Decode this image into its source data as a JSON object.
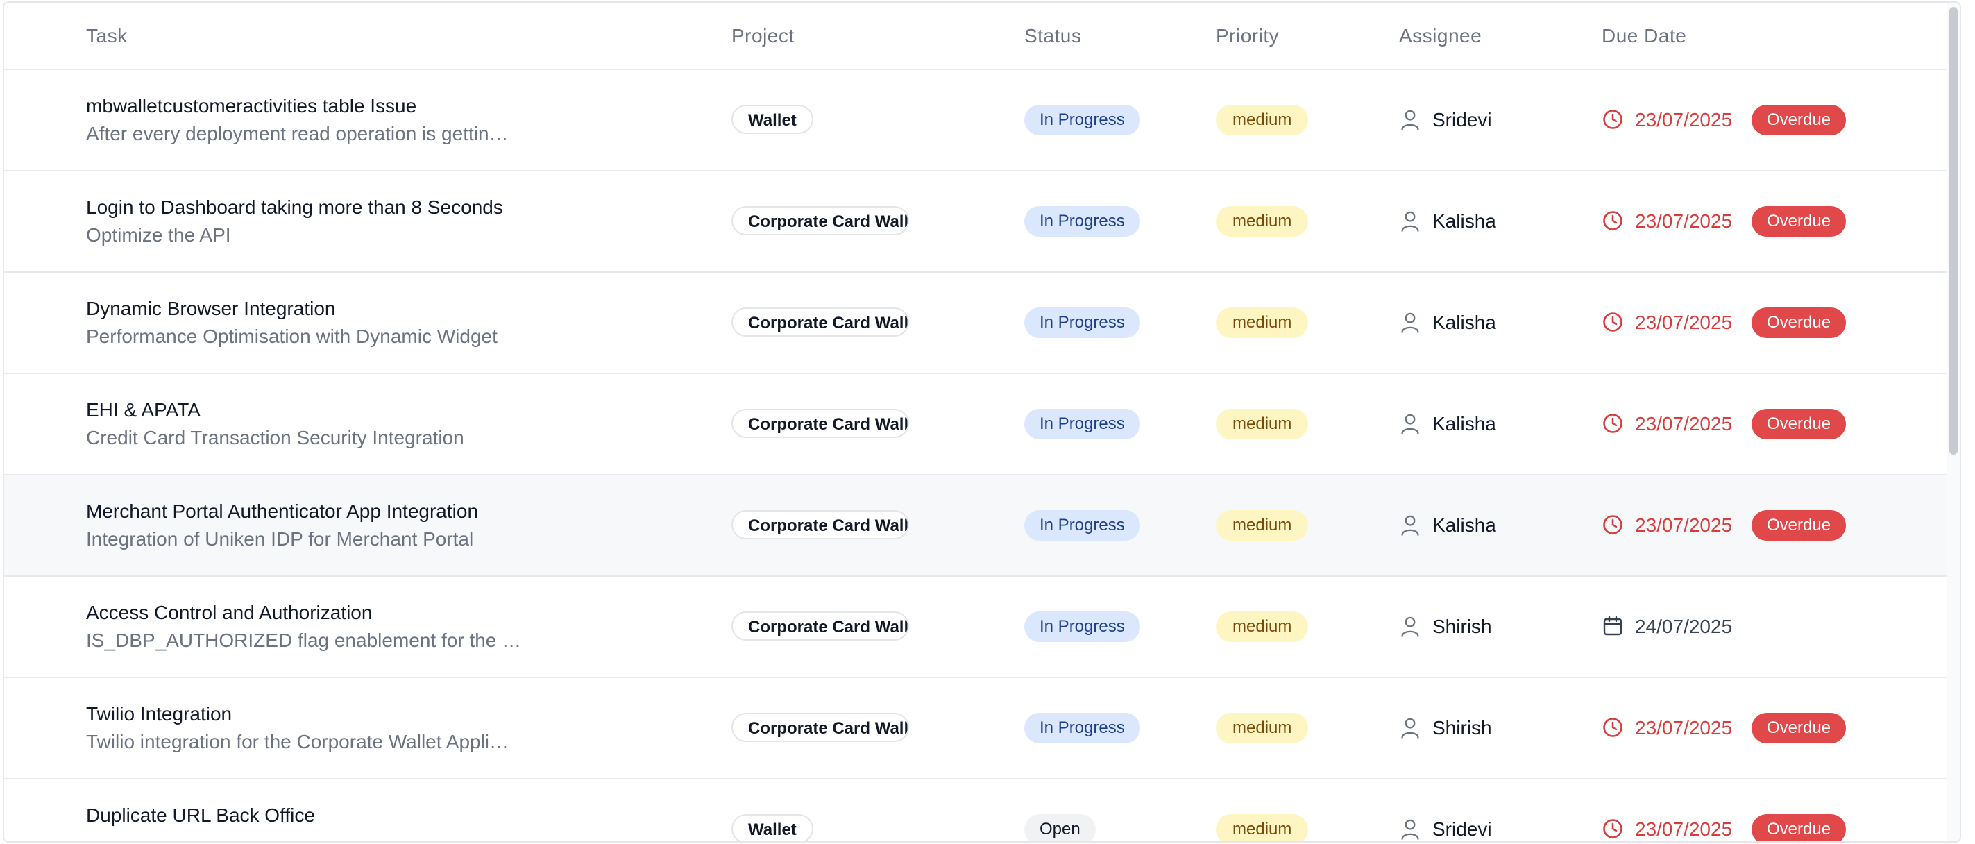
{
  "columns": {
    "task": "Task",
    "project": "Project",
    "status": "Status",
    "priority": "Priority",
    "assignee": "Assignee",
    "due_date": "Due Date"
  },
  "rows": [
    {
      "title": "mbwalletcustomeractivities table Issue",
      "desc": "After every deployment read operation is gettin…",
      "project": "Wallet",
      "status": "In Progress",
      "priority": "medium",
      "assignee": "Sridevi",
      "due": "23/07/2025",
      "overdue_label": "Overdue"
    },
    {
      "title": "Login to Dashboard taking more than 8 Seconds",
      "desc": "Optimize the API",
      "project": "Corporate Card Wallet",
      "status": "In Progress",
      "priority": "medium",
      "assignee": "Kalisha",
      "due": "23/07/2025",
      "overdue_label": "Overdue"
    },
    {
      "title": "Dynamic Browser Integration",
      "desc": "Performance Optimisation with Dynamic Widget",
      "project": "Corporate Card Wallet",
      "status": "In Progress",
      "priority": "medium",
      "assignee": "Kalisha",
      "due": "23/07/2025",
      "overdue_label": "Overdue"
    },
    {
      "title": "EHI & APATA",
      "desc": "Credit Card Transaction Security Integration",
      "project": "Corporate Card Wallet",
      "status": "In Progress",
      "priority": "medium",
      "assignee": "Kalisha",
      "due": "23/07/2025",
      "overdue_label": "Overdue"
    },
    {
      "title": "Merchant Portal Authenticator App Integration",
      "desc": "Integration of Uniken IDP for Merchant Portal",
      "project": "Corporate Card Wallet",
      "status": "In Progress",
      "priority": "medium",
      "assignee": "Kalisha",
      "due": "23/07/2025",
      "overdue_label": "Overdue"
    },
    {
      "title": "Access Control and Authorization",
      "desc": "IS_DBP_AUTHORIZED flag enablement for the …",
      "project": "Corporate Card Wallet",
      "status": "In Progress",
      "priority": "medium",
      "assignee": "Shirish",
      "due": "24/07/2025",
      "overdue_label": ""
    },
    {
      "title": "Twilio Integration",
      "desc": "Twilio integration for the Corporate Wallet Appli…",
      "project": "Corporate Card Wallet",
      "status": "In Progress",
      "priority": "medium",
      "assignee": "Shirish",
      "due": "23/07/2025",
      "overdue_label": "Overdue"
    },
    {
      "title": "Duplicate URL Back Office",
      "desc": "",
      "project": "Wallet",
      "status": "Open",
      "priority": "medium",
      "assignee": "Sridevi",
      "due": "23/07/2025",
      "overdue_label": "Overdue"
    }
  ],
  "colors": {
    "overdue_red": "#dc3b3b",
    "badge_red": "#e0484a",
    "status_blue_bg": "#dbe7fd",
    "priority_yellow_bg": "#fdf6c3"
  }
}
